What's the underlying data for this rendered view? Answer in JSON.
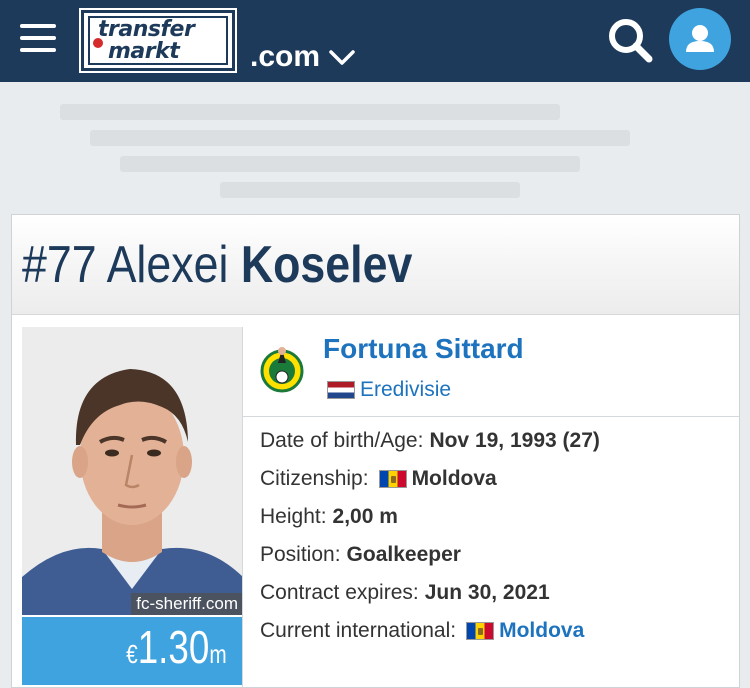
{
  "header": {
    "logo_line1": "transfer",
    "logo_line2": "markt",
    "domain": ".com",
    "icons": [
      "menu-icon",
      "search-icon",
      "user-icon",
      "chevron-down-icon"
    ],
    "colors": {
      "bar": "#1d3a5a",
      "accent": "#3fa3df"
    }
  },
  "player": {
    "number": "#77",
    "first_name": "Alexei",
    "last_name": "Koselev",
    "photo_credit": "fc-sheriff.com",
    "market_value": {
      "currency": "€",
      "amount": "1.30",
      "unit": "m"
    }
  },
  "club": {
    "name": "Fortuna Sittard",
    "league": "Eredivisie",
    "league_flag": "netherlands-flag-icon"
  },
  "info": [
    {
      "label": "Date of birth/Age:",
      "value": "Nov 19, 1993 (27)"
    },
    {
      "label": "Citizenship:",
      "value": "Moldova",
      "flag": "moldova-flag-icon"
    },
    {
      "label": "Height:",
      "value": "2,00 m"
    },
    {
      "label": "Position:",
      "value": "Goalkeeper"
    },
    {
      "label": "Contract expires:",
      "value": "Jun 30, 2021"
    },
    {
      "label": "Current international:",
      "value": "Moldova",
      "flag": "moldova-flag-icon"
    }
  ]
}
